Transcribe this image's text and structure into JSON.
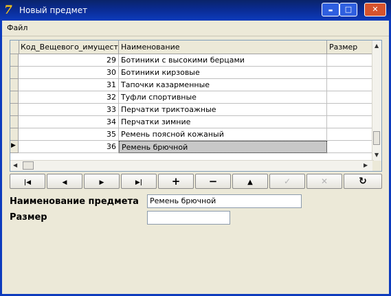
{
  "window": {
    "title": "Новый предмет",
    "app_icon": "delphi-7-icon"
  },
  "title_buttons": {
    "minimize": "▬",
    "maximize": "□",
    "close": "✕"
  },
  "menu": {
    "file": "Файл"
  },
  "grid": {
    "columns": [
      "Код_Вещевого_имущества",
      "Наименование",
      "Размер"
    ],
    "rows": [
      {
        "id": "29",
        "name": "Ботиники с высокими берцами",
        "size": ""
      },
      {
        "id": "30",
        "name": "Ботиники кирзовые",
        "size": ""
      },
      {
        "id": "31",
        "name": "Тапочки казарменные",
        "size": ""
      },
      {
        "id": "32",
        "name": "Туфли спортивные",
        "size": ""
      },
      {
        "id": "33",
        "name": "Перчатки триктоажные",
        "size": ""
      },
      {
        "id": "34",
        "name": "Перчатки зимние",
        "size": ""
      },
      {
        "id": "35",
        "name": "Ремень поясной кожаный",
        "size": ""
      },
      {
        "id": "36",
        "name": "Ремень брючной",
        "size": ""
      }
    ],
    "selected_row": 7,
    "current_row_marker": "▶"
  },
  "navigator": {
    "first": "|◀",
    "prior": "◀",
    "next": "▶",
    "last": "▶|",
    "insert": "+",
    "delete": "−",
    "edit": "▲",
    "post": "✓",
    "cancel": "✕",
    "refresh": "↻"
  },
  "form": {
    "name_label": "Наименование предмета",
    "name_value": "Ремень брючной",
    "size_label": "Размер",
    "size_value": ""
  }
}
